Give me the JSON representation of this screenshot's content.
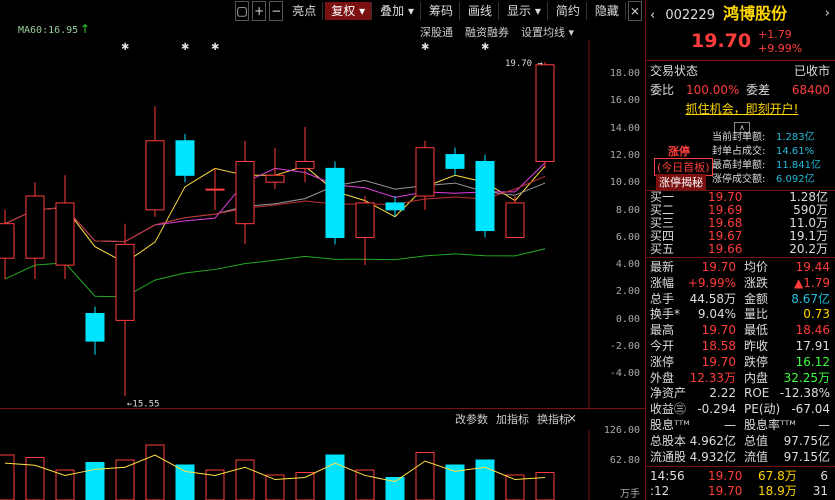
{
  "toolbar": {
    "items": [
      "亮点",
      "复权 ▾",
      "叠加 ▾",
      "筹码",
      "画线",
      "显示 ▾",
      "简约",
      "隐藏"
    ]
  },
  "indicator": {
    "ma60": "MA60:16.95"
  },
  "chart_links": [
    "深股通",
    "融资融券",
    "设置均线 ▾"
  ],
  "chart_data": {
    "type": "candlestick",
    "y_axis_ticks": [
      "18.00",
      "16.00",
      "14.00",
      "12.00",
      "10.00",
      "8.00",
      "6.00",
      "4.00",
      "2.00",
      "0.00",
      "-2.00",
      "-4.00"
    ],
    "annotations": [
      "19.70",
      "15.55"
    ],
    "volume_axis_ticks": [
      "126.00",
      "62.80",
      "万手"
    ],
    "candles": [
      {
        "o": 5.5,
        "c": 8.0,
        "h": 9.0,
        "l": 4.0
      },
      {
        "o": 5.5,
        "c": 10.0,
        "h": 11.0,
        "l": 4.0
      },
      {
        "o": 5.0,
        "c": 9.5,
        "h": 11.5,
        "l": 4.0
      },
      {
        "o": 1.5,
        "c": -0.5,
        "h": 2.0,
        "l": -1.5
      },
      {
        "o": 1.0,
        "c": 6.5,
        "h": 8.0,
        "l": -4.5
      },
      {
        "o": 9.0,
        "c": 14.0,
        "h": 16.5,
        "l": 8.5
      },
      {
        "o": 14.0,
        "c": 11.5,
        "h": 14.5,
        "l": 11.0
      },
      {
        "o": 10.5,
        "c": 10.5,
        "h": 12.0,
        "l": 9.0
      },
      {
        "o": 8.0,
        "c": 12.5,
        "h": 14.0,
        "l": 6.5
      },
      {
        "o": 11.0,
        "c": 11.5,
        "h": 13.5,
        "l": 10.5
      },
      {
        "o": 12.0,
        "c": 12.5,
        "h": 15.0,
        "l": 11.0
      },
      {
        "o": 12.0,
        "c": 7.0,
        "h": 12.5,
        "l": 6.5
      },
      {
        "o": 7.0,
        "c": 9.5,
        "h": 10.0,
        "l": 5.0
      },
      {
        "o": 9.5,
        "c": 9.0,
        "h": 10.0,
        "l": 8.5
      },
      {
        "o": 10.0,
        "c": 13.5,
        "h": 14.0,
        "l": 9.0
      },
      {
        "o": 13.0,
        "c": 12.0,
        "h": 13.5,
        "l": 11.5
      },
      {
        "o": 12.5,
        "c": 7.5,
        "h": 13.0,
        "l": 7.0
      },
      {
        "o": 7.0,
        "c": 9.5,
        "h": 10.0,
        "l": 7.0
      },
      {
        "o": 12.5,
        "c": 19.5,
        "h": 19.7,
        "l": 12.0
      }
    ],
    "volume": [
      90,
      85,
      60,
      75,
      80,
      110,
      70,
      60,
      80,
      50,
      55,
      90,
      60,
      45,
      95,
      70,
      80,
      50,
      55
    ]
  },
  "volume_links": [
    "改参数",
    "加指标",
    "换指标"
  ],
  "stock": {
    "code": "002229",
    "name": "鸿博股份",
    "price": "19.70",
    "change": "+1.79",
    "pct": "+9.99%"
  },
  "status": {
    "label": "交易状态",
    "value": "已收市"
  },
  "wei": {
    "label": "委比",
    "value": "100.00%",
    "label2": "委差",
    "value2": "68400"
  },
  "ad": "抓住机会，即刻开户!",
  "limit": {
    "tag": "涨停",
    "sub": "(今日首板)",
    "btn": "涨停揭秘",
    "rows": [
      {
        "label": "当前封单额:",
        "value": "1.283亿"
      },
      {
        "label": "封单占成交:",
        "value": "14.61%"
      },
      {
        "label": "最高封单额:",
        "value": "11.841亿"
      },
      {
        "label": "涨停成交额:",
        "value": "6.092亿"
      }
    ]
  },
  "bids": [
    {
      "label": "买一",
      "price": "19.70",
      "vol": "1.28亿"
    },
    {
      "label": "买二",
      "price": "19.69",
      "vol": "590万"
    },
    {
      "label": "买三",
      "price": "19.68",
      "vol": "11.0万"
    },
    {
      "label": "买四",
      "price": "19.67",
      "vol": "19.1万"
    },
    {
      "label": "买五",
      "price": "19.66",
      "vol": "20.2万"
    }
  ],
  "stats": [
    {
      "l1": "最新",
      "v1": "19.70",
      "c1": "red",
      "l2": "均价",
      "v2": "19.44",
      "c2": "red"
    },
    {
      "l1": "涨幅",
      "v1": "+9.99%",
      "c1": "red",
      "l2": "涨跌",
      "v2": "▲1.79",
      "c2": "red"
    },
    {
      "l1": "总手",
      "v1": "44.58万",
      "c1": "white",
      "l2": "金额",
      "v2": "8.67亿",
      "c2": "cyan"
    },
    {
      "l1": "换手*",
      "v1": "9.04%",
      "c1": "white",
      "l2": "量比",
      "v2": "0.73",
      "c2": "yellow"
    },
    {
      "l1": "最高",
      "v1": "19.70",
      "c1": "red",
      "l2": "最低",
      "v2": "18.46",
      "c2": "red"
    },
    {
      "l1": "今开",
      "v1": "18.58",
      "c1": "red",
      "l2": "昨收",
      "v2": "17.91",
      "c2": "white"
    },
    {
      "l1": "涨停",
      "v1": "19.70",
      "c1": "red",
      "l2": "跌停",
      "v2": "16.12",
      "c2": "green"
    },
    {
      "l1": "外盘",
      "v1": "12.33万",
      "c1": "red",
      "l2": "内盘",
      "v2": "32.25万",
      "c2": "green"
    },
    {
      "l1": "净资产",
      "v1": "2.22",
      "c1": "white",
      "l2": "ROE",
      "v2": "-12.38%",
      "c2": "white"
    },
    {
      "l1": "收益㊂",
      "v1": "-0.294",
      "c1": "white",
      "l2": "PE(动)",
      "v2": "-67.04",
      "c2": "white"
    },
    {
      "l1": "股息ᵀᵀᴹ",
      "v1": "—",
      "c1": "white",
      "l2": "股息率ᵀᵀᴹ",
      "v2": "—",
      "c2": "white"
    },
    {
      "l1": "总股本",
      "v1": "4.962亿",
      "c1": "white",
      "l2": "总值",
      "v2": "97.75亿",
      "c2": "white"
    },
    {
      "l1": "流通股",
      "v1": "4.932亿",
      "c1": "white",
      "l2": "流值",
      "v2": "97.15亿",
      "c2": "white"
    }
  ],
  "ticks": [
    {
      "t": "14:56",
      "p": "19.70",
      "v": "67.8万",
      "n": "6"
    },
    {
      "t": ":12",
      "p": "19.70",
      "v": "18.9万",
      "n": "31"
    }
  ]
}
